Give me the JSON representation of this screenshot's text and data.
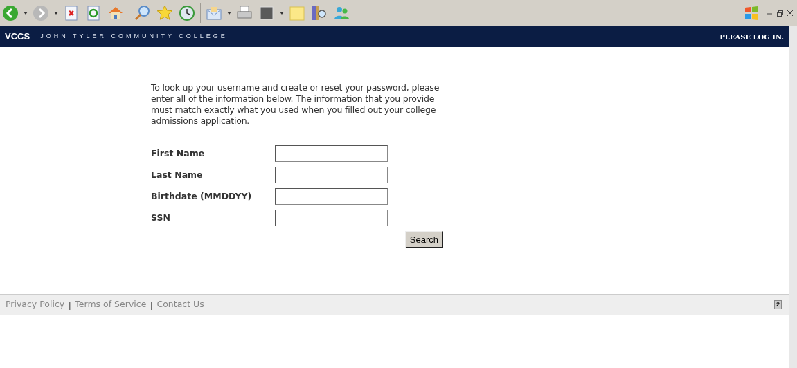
{
  "header": {
    "logo": "VCCS",
    "college": "JOHN TYLER COMMUNITY COLLEGE",
    "login": "PLEASE LOG IN."
  },
  "intro": "To look up your username and create or reset your password, please enter all of the information below. The information that you provide must match exactly what you used when you filled out your college admissions application.",
  "form": {
    "fields": [
      {
        "label": "First Name"
      },
      {
        "label": "Last Name"
      },
      {
        "label": "Birthdate (MMDDYY)"
      },
      {
        "label": "SSN"
      }
    ],
    "button": "Search"
  },
  "footer": {
    "links": [
      "Privacy Policy",
      "Terms of Service",
      "Contact Us"
    ],
    "separator": "|",
    "badge": "2"
  }
}
